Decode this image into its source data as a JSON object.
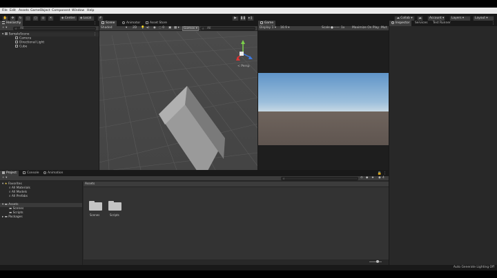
{
  "menu": [
    "File",
    "Edit",
    "Assets",
    "GameObject",
    "Component",
    "Window",
    "Help"
  ],
  "toolbar": {
    "pivot": "Center",
    "space": "Local",
    "account_button": "Collab",
    "account_label": "Account",
    "layers_label": "Layers",
    "layout_label": "Layout"
  },
  "hierarchy": {
    "tab": "Hierarchy",
    "search_placeholder": "All",
    "scene": "SampleScene",
    "objects": [
      "Camera",
      "Directional Light",
      "Cube"
    ]
  },
  "scene_view": {
    "tabs": [
      "Scene",
      "Animator",
      "Asset Store"
    ],
    "shading": "Shaded",
    "mode_2d": "2D",
    "gizmos": "Gizmos",
    "search_placeholder": "All",
    "persp_label": "< Persp"
  },
  "game_view": {
    "tab": "Game",
    "display": "Display 1",
    "aspect": "16:9",
    "scale_label": "Scale",
    "scale_value": "1x",
    "maximize": "Maximize On Play",
    "mute": "Mut"
  },
  "inspector": {
    "tabs": [
      "Inspector",
      "Services",
      "Test Runner"
    ]
  },
  "project": {
    "tabs": [
      "Project",
      "Console",
      "Animation"
    ],
    "favorites_label": "Favorites",
    "favorites": [
      "All Materials",
      "All Models",
      "All Prefabs"
    ],
    "assets_label": "Assets",
    "asset_children": [
      "Scenes",
      "Scripts"
    ],
    "packages_label": "Packages",
    "breadcrumb": "Assets",
    "folders": [
      "Scenes",
      "Scripts"
    ],
    "hidden_count": "4"
  },
  "status": {
    "lighting": "Auto Generate Lighting Off"
  },
  "colors": {
    "accent": "#2c5d87",
    "panel": "#282828",
    "tab_active": "#3c3c3c",
    "sky_top": "#5f94c8",
    "ground": "#5f5550"
  }
}
